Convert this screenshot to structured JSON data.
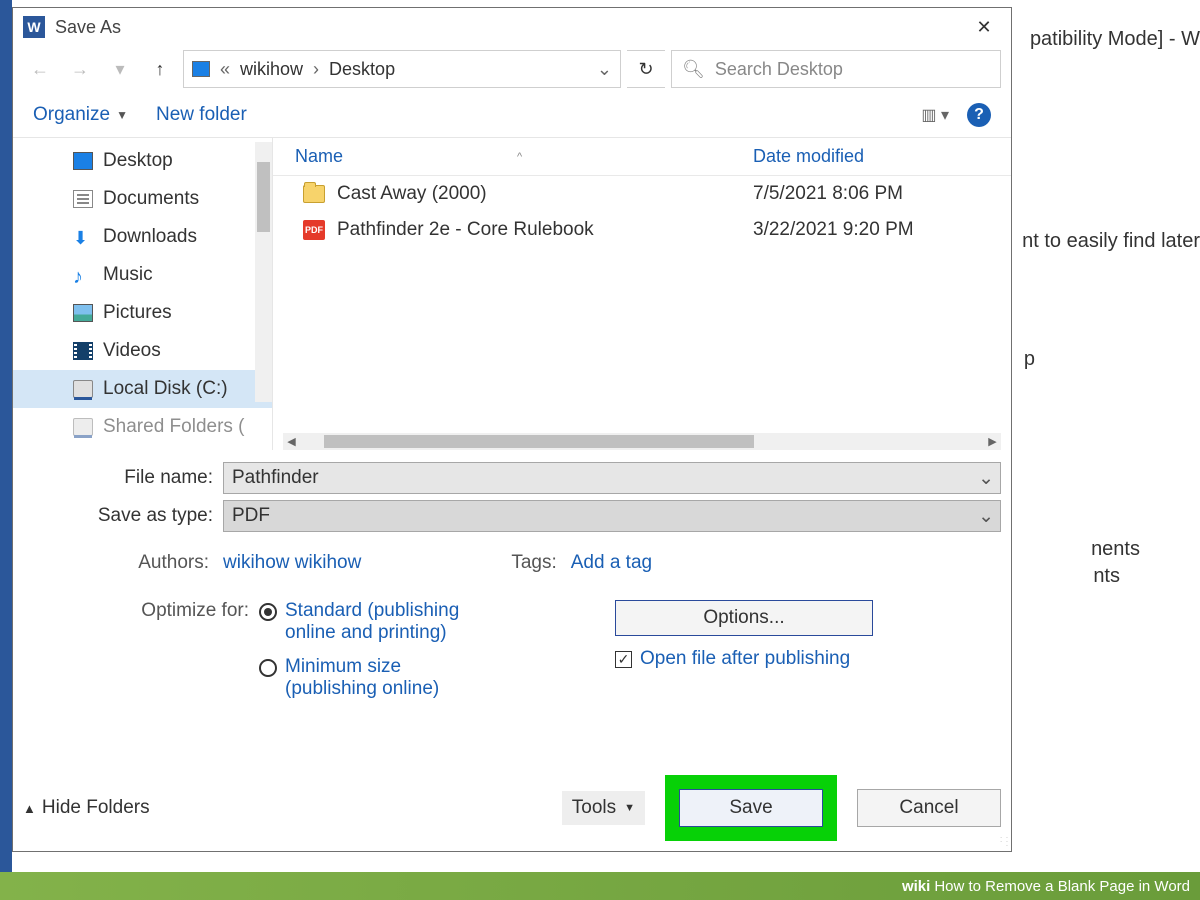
{
  "background": {
    "title_suffix": "patibility Mode]  -  W",
    "hint": "nt to easily find later",
    "side_heading": "nents",
    "side_sub": "nts",
    "mid": "p"
  },
  "dialog": {
    "title": "Save As",
    "breadcrumb": {
      "sep": "«",
      "p1": "wikihow",
      "p2": "Desktop"
    },
    "search_placeholder": "Search Desktop",
    "organize": "Organize",
    "new_folder": "New folder"
  },
  "sidebar": {
    "items": [
      {
        "label": "Desktop"
      },
      {
        "label": "Documents"
      },
      {
        "label": "Downloads"
      },
      {
        "label": "Music"
      },
      {
        "label": "Pictures"
      },
      {
        "label": "Videos"
      },
      {
        "label": "Local Disk (C:)"
      },
      {
        "label": "Shared Folders ("
      }
    ]
  },
  "columns": {
    "name": "Name",
    "modified": "Date modified"
  },
  "files": [
    {
      "name": "Cast Away (2000)",
      "date": "7/5/2021 8:06 PM",
      "type": "folder"
    },
    {
      "name": "Pathfinder 2e - Core Rulebook",
      "date": "3/22/2021 9:20 PM",
      "type": "pdf"
    }
  ],
  "fields": {
    "filename_label": "File name:",
    "filename_value": "Pathfinder",
    "type_label": "Save as type:",
    "type_value": "PDF",
    "authors_label": "Authors:",
    "authors_value": "wikihow wikihow",
    "tags_label": "Tags:",
    "tags_value": "Add a tag",
    "optimize_label": "Optimize for:",
    "opt_standard": "Standard (publishing online and printing)",
    "opt_minimum": "Minimum size (publishing online)",
    "options_btn": "Options...",
    "open_after": "Open file after publishing"
  },
  "footer": {
    "hide": "Hide Folders",
    "tools": "Tools",
    "save": "Save",
    "cancel": "Cancel"
  },
  "banner": {
    "brand": "wiki",
    "title": "How to Remove a Blank Page in Word"
  },
  "pdf_badge": "PDF"
}
